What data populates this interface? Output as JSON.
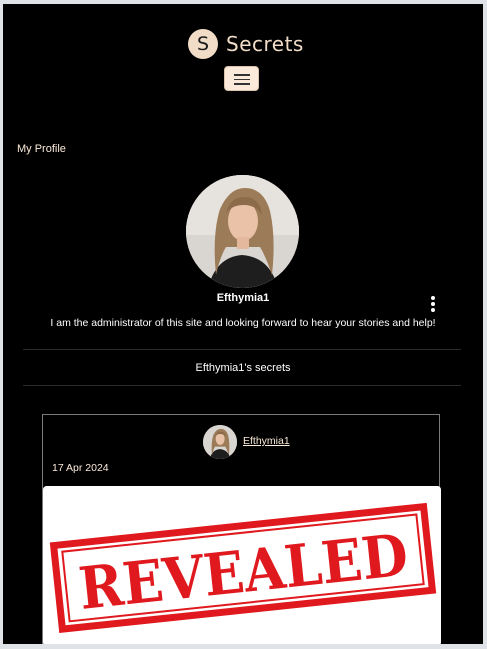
{
  "navbar": {
    "brand_letter": "S",
    "brand_name": "Secrets",
    "menu_icon": "hamburger-icon"
  },
  "profile": {
    "section_label": "My Profile",
    "username": "Efthymia1",
    "bio": "I am the administrator of this site and looking forward to hear your stories and help!",
    "options_icon": "kebab-menu-icon"
  },
  "secrets": {
    "heading": "Efthymia1's secrets",
    "posts": [
      {
        "author": "Efthymia1",
        "date": "17 Apr 2024",
        "image_text": "REVEALED"
      }
    ]
  },
  "colors": {
    "background": "#000000",
    "accent": "#f1dcc7",
    "stamp_red": "#e0191f"
  }
}
